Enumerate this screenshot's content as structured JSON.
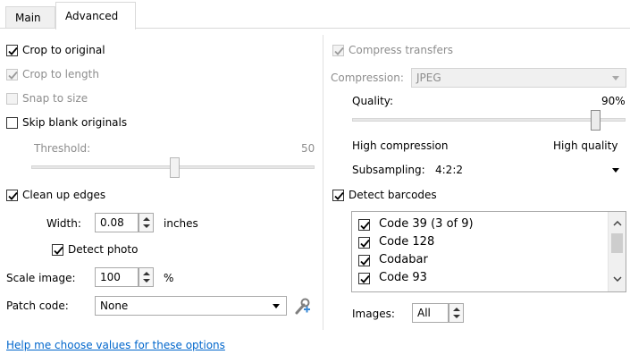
{
  "tabs": [
    {
      "label": "Main",
      "active": false
    },
    {
      "label": "Advanced",
      "active": true
    }
  ],
  "left": {
    "crop_to_original": {
      "label": "Crop to original",
      "checked": true,
      "enabled": true
    },
    "crop_to_length": {
      "label": "Crop to length",
      "checked": true,
      "enabled": false
    },
    "snap_to_size": {
      "label": "Snap to size",
      "checked": false,
      "enabled": false
    },
    "skip_blank": {
      "label": "Skip blank originals",
      "checked": false,
      "enabled": true
    },
    "threshold": {
      "label": "Threshold:",
      "value": "50",
      "level": 50,
      "enabled": false
    },
    "clean_up_edges": {
      "label": "Clean up edges",
      "checked": true,
      "enabled": true
    },
    "width": {
      "label": "Width:",
      "value": "0.08",
      "unit": "inches"
    },
    "detect_photo": {
      "label": "Detect photo",
      "checked": true
    },
    "scale_image": {
      "label": "Scale image:",
      "value": "100",
      "unit": "%"
    },
    "patch_code": {
      "label": "Patch code:",
      "value": "None",
      "icon": "wrench-plus-icon"
    }
  },
  "right": {
    "compress_transfers": {
      "label": "Compress transfers",
      "checked": true,
      "enabled": false
    },
    "compression": {
      "label": "Compression:",
      "value": "JPEG",
      "enabled": false
    },
    "quality": {
      "label": "Quality:",
      "value": "90%",
      "level": 90
    },
    "quality_min_label": "High compression",
    "quality_max_label": "High quality",
    "subsampling": {
      "label": "Subsampling:",
      "value": "4:2:2"
    },
    "detect_barcodes": {
      "label": "Detect barcodes",
      "checked": true
    },
    "barcodes": [
      {
        "label": "Code 39 (3 of 9)",
        "checked": true
      },
      {
        "label": "Code 128",
        "checked": true
      },
      {
        "label": "Codabar",
        "checked": true
      },
      {
        "label": "Code 93",
        "checked": true
      }
    ],
    "images": {
      "label": "Images:",
      "value": "All"
    }
  },
  "help_link": "Help me choose values for these options",
  "colors": {
    "link": "#0066cc",
    "disabled_text": "#8d8d8d"
  }
}
